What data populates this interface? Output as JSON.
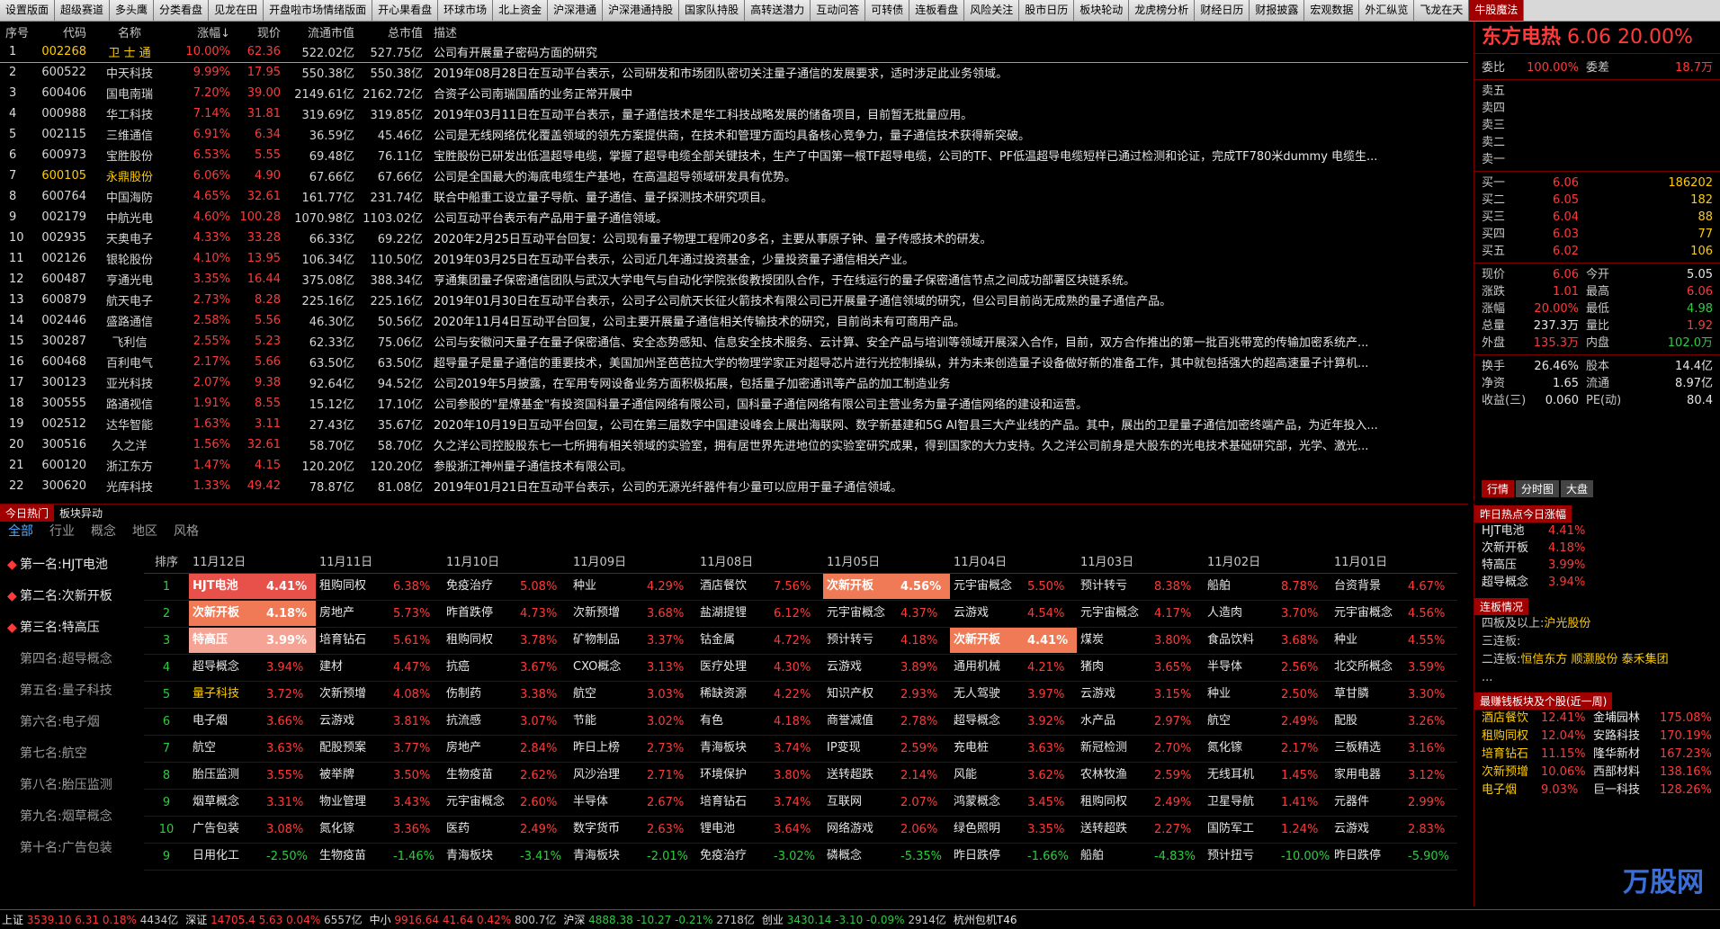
{
  "top_tabs": [
    "设置版面",
    "超级赛道",
    "多头鹰",
    "分类看盘",
    "见龙在田",
    "开盘啦市场情绪版面",
    "开心果看盘",
    "环球市场",
    "北上资金",
    "沪深港通",
    "沪深港通持股",
    "国家队持股",
    "高转送潜力",
    "互动问答",
    "可转债",
    "连板看盘",
    "风险关注",
    "股市日历",
    "板块轮动",
    "龙虎榜分析",
    "财经日历",
    "财报披露",
    "宏观数据",
    "外汇纵览",
    "飞龙在天",
    "牛股魔法"
  ],
  "stock_table": {
    "headers": [
      "序号",
      "代码",
      "名称",
      "涨幅↓",
      "现价",
      "流通市值",
      "总市值",
      "描述"
    ],
    "rows": [
      {
        "idx": "1",
        "code": "002268",
        "name": "卫 士 通",
        "chg": "10.00%",
        "price": "62.36",
        "float_cap": "522.02亿",
        "total_cap": "527.75亿",
        "desc": "公司有开展量子密码方面的研究"
      },
      {
        "idx": "2",
        "code": "600522",
        "name": "中天科技",
        "chg": "9.99%",
        "price": "17.95",
        "float_cap": "550.38亿",
        "total_cap": "550.38亿",
        "desc": "2019年08月28日在互动平台表示，公司研发和市场团队密切关注量子通信的发展要求，适时涉足此业务领域。"
      },
      {
        "idx": "3",
        "code": "600406",
        "name": "国电南瑞",
        "chg": "7.20%",
        "price": "39.00",
        "float_cap": "2149.61亿",
        "total_cap": "2162.72亿",
        "desc": "合资子公司南瑞国盾的业务正常开展中"
      },
      {
        "idx": "4",
        "code": "000988",
        "name": "华工科技",
        "chg": "7.14%",
        "price": "31.81",
        "float_cap": "319.69亿",
        "total_cap": "319.85亿",
        "desc": "2019年03月11日在互动平台表示，量子通信技术是华工科技战略发展的储备项目，目前暂无批量应用。"
      },
      {
        "idx": "5",
        "code": "002115",
        "name": "三维通信",
        "chg": "6.91%",
        "price": "6.34",
        "float_cap": "36.59亿",
        "total_cap": "45.46亿",
        "desc": "公司是无线网络优化覆盖领域的领先方案提供商，在技术和管理方面均具备核心竞争力，量子通信技术获得新突破。"
      },
      {
        "idx": "6",
        "code": "600973",
        "name": "宝胜股份",
        "chg": "6.53%",
        "price": "5.55",
        "float_cap": "69.48亿",
        "total_cap": "76.11亿",
        "desc": "宝胜股份已研发出低温超导电缆，掌握了超导电缆全部关键技术，生产了中国第一根TF超导电缆，公司的TF、PF低温超导电缆短样已通过检测和论证，完成TF780米dummy 电缆生..."
      },
      {
        "idx": "7",
        "code": "600105",
        "name": "永鼎股份",
        "chg": "6.06%",
        "price": "4.90",
        "float_cap": "67.66亿",
        "total_cap": "67.66亿",
        "desc": "公司是全国最大的海底电缆生产基地，在高温超导领域研发具有优势。"
      },
      {
        "idx": "8",
        "code": "600764",
        "name": "中国海防",
        "chg": "4.65%",
        "price": "32.61",
        "float_cap": "161.77亿",
        "total_cap": "231.74亿",
        "desc": "联合中船重工设立量子导航、量子通信、量子探测技术研究项目。"
      },
      {
        "idx": "9",
        "code": "002179",
        "name": "中航光电",
        "chg": "4.60%",
        "price": "100.28",
        "float_cap": "1070.98亿",
        "total_cap": "1103.02亿",
        "desc": "公司互动平台表示有产品用于量子通信领域。"
      },
      {
        "idx": "10",
        "code": "002935",
        "name": "天奥电子",
        "chg": "4.33%",
        "price": "33.28",
        "float_cap": "66.33亿",
        "total_cap": "69.22亿",
        "desc": "2020年2月25日互动平台回复：公司现有量子物理工程师20多名，主要从事原子钟、量子传感技术的研发。"
      },
      {
        "idx": "11",
        "code": "002126",
        "name": "银轮股份",
        "chg": "4.10%",
        "price": "13.95",
        "float_cap": "106.34亿",
        "total_cap": "110.50亿",
        "desc": "2019年03月25日在互动平台表示，公司近几年通过投资基金，少量投资量子通信相关产业。"
      },
      {
        "idx": "12",
        "code": "600487",
        "name": "亨通光电",
        "chg": "3.35%",
        "price": "16.44",
        "float_cap": "375.08亿",
        "total_cap": "388.34亿",
        "desc": "亨通集团量子保密通信团队与武汉大学电气与自动化学院张俊教授团队合作，于在线运行的量子保密通信节点之间成功部署区块链系统。"
      },
      {
        "idx": "13",
        "code": "600879",
        "name": "航天电子",
        "chg": "2.73%",
        "price": "8.28",
        "float_cap": "225.16亿",
        "total_cap": "225.16亿",
        "desc": "2019年01月30日在互动平台表示，公司子公司航天长征火箭技术有限公司已开展量子通信领域的研究，但公司目前尚无成熟的量子通信产品。"
      },
      {
        "idx": "14",
        "code": "002446",
        "name": "盛路通信",
        "chg": "2.58%",
        "price": "5.56",
        "float_cap": "46.30亿",
        "total_cap": "50.56亿",
        "desc": "2020年11月4日互动平台回复，公司主要开展量子通信相关传输技术的研究，目前尚未有可商用产品。"
      },
      {
        "idx": "15",
        "code": "300287",
        "name": "飞利信",
        "chg": "2.55%",
        "price": "5.23",
        "float_cap": "62.33亿",
        "total_cap": "75.06亿",
        "desc": "公司与安徽问天量子在量子保密通信、安全态势感知、信息安全技术服务、云计算、安全产品与培训等领域开展深入合作，目前，双方合作推出的第一批百兆带宽的传输加密系统产..."
      },
      {
        "idx": "16",
        "code": "600468",
        "name": "百利电气",
        "chg": "2.17%",
        "price": "5.66",
        "float_cap": "63.50亿",
        "total_cap": "63.50亿",
        "desc": "超导量子是量子通信的重要技术，美国加州圣芭芭拉大学的物理学家正对超导芯片进行光控制操纵，并为未来创造量子设备做好新的准备工作，其中就包括强大的超高速量子计算机..."
      },
      {
        "idx": "17",
        "code": "300123",
        "name": "亚光科技",
        "chg": "2.07%",
        "price": "9.38",
        "float_cap": "92.64亿",
        "total_cap": "94.52亿",
        "desc": "公司2019年5月披露，在军用专网设备业务方面积极拓展，包括量子加密通讯等产品的加工制造业务"
      },
      {
        "idx": "18",
        "code": "300555",
        "name": "路通视信",
        "chg": "1.91%",
        "price": "8.55",
        "float_cap": "15.12亿",
        "total_cap": "17.10亿",
        "desc": "公司参股的\"星燎基金\"有投资国科量子通信网络有限公司，国科量子通信网络有限公司主营业务为量子通信网络的建设和运营。"
      },
      {
        "idx": "19",
        "code": "002512",
        "name": "达华智能",
        "chg": "1.63%",
        "price": "3.11",
        "float_cap": "27.43亿",
        "total_cap": "35.67亿",
        "desc": "2020年10月19日互动平台回复，公司在第三届数字中国建设峰会上展出海联网、数字新基建和5G AI智县三大产业线的产品。其中，展出的卫星量子通信加密终端产品，为近年投入..."
      },
      {
        "idx": "20",
        "code": "300516",
        "name": "久之洋",
        "chg": "1.56%",
        "price": "32.61",
        "float_cap": "58.70亿",
        "total_cap": "58.70亿",
        "desc": "久之洋公司控股股东七一七所拥有相关领域的实验室，拥有居世界先进地位的实验室研究成果，得到国家的大力支持。久之洋公司前身是大股东的光电技术基础研究部，光学、激光..."
      },
      {
        "idx": "21",
        "code": "600120",
        "name": "浙江东方",
        "chg": "1.47%",
        "price": "4.15",
        "float_cap": "120.20亿",
        "total_cap": "120.20亿",
        "desc": "参股浙江神州量子通信技术有限公司。"
      },
      {
        "idx": "22",
        "code": "300620",
        "name": "光库科技",
        "chg": "1.33%",
        "price": "49.42",
        "float_cap": "78.87亿",
        "total_cap": "81.08亿",
        "desc": "2019年01月21日在互动平台表示，公司的无源光纤器件有少量可以应用于量子通信领域。"
      }
    ]
  },
  "quote": {
    "name": "东方电热",
    "price": "6.06",
    "chg": "20.00%",
    "weibi_label": "委比",
    "weibi": "100.00%",
    "weicha_label": "委差",
    "weicha": "18.7万",
    "sell": [
      {
        "label": "卖五",
        "price": "",
        "vol": ""
      },
      {
        "label": "卖四",
        "price": "",
        "vol": ""
      },
      {
        "label": "卖三",
        "price": "",
        "vol": ""
      },
      {
        "label": "卖二",
        "price": "",
        "vol": ""
      },
      {
        "label": "卖一",
        "price": "",
        "vol": ""
      }
    ],
    "buy": [
      {
        "label": "买一",
        "price": "6.06",
        "vol": "186202"
      },
      {
        "label": "买二",
        "price": "6.05",
        "vol": "182"
      },
      {
        "label": "买三",
        "price": "6.04",
        "vol": "88"
      },
      {
        "label": "买四",
        "price": "6.03",
        "vol": "77"
      },
      {
        "label": "买五",
        "price": "6.02",
        "vol": "106"
      }
    ],
    "stats": [
      {
        "l1": "现价",
        "v1": "6.06",
        "l2": "今开",
        "v2": "5.05"
      },
      {
        "l1": "涨跌",
        "v1": "1.01",
        "l2": "最高",
        "v2": "6.06"
      },
      {
        "l1": "涨幅",
        "v1": "20.00%",
        "l2": "最低",
        "v2": "4.98"
      },
      {
        "l1": "总量",
        "v1": "237.3万",
        "l2": "量比",
        "v2": "1.92"
      },
      {
        "l1": "外盘",
        "v1": "135.3万",
        "l2": "内盘",
        "v2": "102.0万"
      }
    ],
    "stats2": [
      {
        "l1": "换手",
        "v1": "26.46%",
        "l2": "股本",
        "v2": "14.4亿"
      },
      {
        "l1": "净资",
        "v1": "1.65",
        "l2": "流通",
        "v2": "8.97亿"
      },
      {
        "l1": "收益(三)",
        "v1": "0.060",
        "l2": "PE(动)",
        "v2": "80.4"
      }
    ],
    "tabs": [
      "行情",
      "分时图",
      "大盘"
    ]
  },
  "hot": {
    "tabs": [
      "今日热门",
      "板块异动"
    ],
    "filters": [
      "全部",
      "行业",
      "概念",
      "地区",
      "风格"
    ],
    "ranks": [
      {
        "label": "第一名:HJT电池",
        "top": true
      },
      {
        "label": "第二名:次新开板",
        "top": true
      },
      {
        "label": "第三名:特高压",
        "top": true
      },
      {
        "label": "第四名:超导概念",
        "top": false
      },
      {
        "label": "第五名:量子科技",
        "top": false
      },
      {
        "label": "第六名:电子烟",
        "top": false
      },
      {
        "label": "第七名:航空",
        "top": false
      },
      {
        "label": "第八名:胎压监测",
        "top": false
      },
      {
        "label": "第九名:烟草概念",
        "top": false
      },
      {
        "label": "第十名:广告包装",
        "top": false
      }
    ],
    "rank_header": "排序",
    "dates": [
      "11月12日",
      "11月11日",
      "11月10日",
      "11月09日",
      "11月08日",
      "11月05日",
      "11月04日",
      "11月03日",
      "11月02日",
      "11月01日"
    ],
    "rank_nums": [
      "1",
      "2",
      "3",
      "4",
      "5",
      "6",
      "7",
      "8",
      "9",
      "10",
      "9"
    ],
    "rows": [
      [
        [
          "HJT电池",
          "4.41%"
        ],
        [
          "租购同权",
          "6.38%"
        ],
        [
          "免疫治疗",
          "5.08%"
        ],
        [
          "种业",
          "4.29%"
        ],
        [
          "酒店餐饮",
          "7.56%"
        ],
        [
          "次新开板",
          "4.56%"
        ],
        [
          "元宇宙概念",
          "5.50%"
        ],
        [
          "预计转亏",
          "8.38%"
        ],
        [
          "船舶",
          "8.78%"
        ],
        [
          "台资背景",
          "4.67%"
        ]
      ],
      [
        [
          "次新开板",
          "4.18%"
        ],
        [
          "房地产",
          "5.73%"
        ],
        [
          "昨首跌停",
          "4.73%"
        ],
        [
          "次新预增",
          "3.68%"
        ],
        [
          "盐湖提锂",
          "6.12%"
        ],
        [
          "元宇宙概念",
          "4.37%"
        ],
        [
          "云游戏",
          "4.54%"
        ],
        [
          "元宇宙概念",
          "4.17%"
        ],
        [
          "人造肉",
          "3.70%"
        ],
        [
          "元宇宙概念",
          "4.56%"
        ]
      ],
      [
        [
          "特高压",
          "3.99%"
        ],
        [
          "培育钻石",
          "5.61%"
        ],
        [
          "租购同权",
          "3.78%"
        ],
        [
          "矿物制品",
          "3.37%"
        ],
        [
          "钴金属",
          "4.72%"
        ],
        [
          "预计转亏",
          "4.18%"
        ],
        [
          "次新开板",
          "4.41%"
        ],
        [
          "煤炭",
          "3.80%"
        ],
        [
          "食品饮料",
          "3.68%"
        ],
        [
          "种业",
          "4.55%"
        ]
      ],
      [
        [
          "超导概念",
          "3.94%"
        ],
        [
          "建材",
          "4.47%"
        ],
        [
          "抗癌",
          "3.67%"
        ],
        [
          "CXO概念",
          "3.13%"
        ],
        [
          "医疗处理",
          "4.30%"
        ],
        [
          "云游戏",
          "3.89%"
        ],
        [
          "通用机械",
          "4.21%"
        ],
        [
          "猪肉",
          "3.65%"
        ],
        [
          "半导体",
          "2.56%"
        ],
        [
          "北交所概念",
          "3.59%"
        ]
      ],
      [
        [
          "量子科技",
          "3.72%"
        ],
        [
          "次新预增",
          "4.08%"
        ],
        [
          "伤制药",
          "3.38%"
        ],
        [
          "航空",
          "3.03%"
        ],
        [
          "稀缺资源",
          "4.22%"
        ],
        [
          "知识产权",
          "2.93%"
        ],
        [
          "无人驾驶",
          "3.97%"
        ],
        [
          "云游戏",
          "3.15%"
        ],
        [
          "种业",
          "2.50%"
        ],
        [
          "草甘膦",
          "3.30%"
        ]
      ],
      [
        [
          "电子烟",
          "3.66%"
        ],
        [
          "云游戏",
          "3.81%"
        ],
        [
          "抗流感",
          "3.07%"
        ],
        [
          "节能",
          "3.02%"
        ],
        [
          "有色",
          "4.18%"
        ],
        [
          "商誉减值",
          "2.78%"
        ],
        [
          "超导概念",
          "3.92%"
        ],
        [
          "水产品",
          "2.97%"
        ],
        [
          "航空",
          "2.49%"
        ],
        [
          "配股",
          "3.26%"
        ]
      ],
      [
        [
          "航空",
          "3.63%"
        ],
        [
          "配股预案",
          "3.77%"
        ],
        [
          "房地产",
          "2.84%"
        ],
        [
          "昨日上榜",
          "2.73%"
        ],
        [
          "青海板块",
          "3.74%"
        ],
        [
          "IP变现",
          "2.59%"
        ],
        [
          "充电桩",
          "3.63%"
        ],
        [
          "新冠检测",
          "2.70%"
        ],
        [
          "氮化镓",
          "2.17%"
        ],
        [
          "三板精选",
          "3.16%"
        ]
      ],
      [
        [
          "胎压监测",
          "3.55%"
        ],
        [
          "被举牌",
          "3.50%"
        ],
        [
          "生物疫苗",
          "2.62%"
        ],
        [
          "风沙治理",
          "2.71%"
        ],
        [
          "环境保护",
          "3.80%"
        ],
        [
          "送转超跌",
          "2.14%"
        ],
        [
          "风能",
          "3.62%"
        ],
        [
          "农林牧渔",
          "2.59%"
        ],
        [
          "无线耳机",
          "1.45%"
        ],
        [
          "家用电器",
          "3.12%"
        ]
      ],
      [
        [
          "烟草概念",
          "3.31%"
        ],
        [
          "物业管理",
          "3.43%"
        ],
        [
          "元宇宙概念",
          "2.60%"
        ],
        [
          "半导体",
          "2.67%"
        ],
        [
          "培育钻石",
          "3.74%"
        ],
        [
          "互联网",
          "2.07%"
        ],
        [
          "鸿蒙概念",
          "3.45%"
        ],
        [
          "租购同权",
          "2.49%"
        ],
        [
          "卫星导航",
          "1.41%"
        ],
        [
          "元器件",
          "2.99%"
        ]
      ],
      [
        [
          "广告包装",
          "3.08%"
        ],
        [
          "氮化镓",
          "3.36%"
        ],
        [
          "医药",
          "2.49%"
        ],
        [
          "数字货币",
          "2.63%"
        ],
        [
          "锂电池",
          "3.64%"
        ],
        [
          "网络游戏",
          "2.06%"
        ],
        [
          "绿色照明",
          "3.35%"
        ],
        [
          "送转超跌",
          "2.27%"
        ],
        [
          "国防军工",
          "1.24%"
        ],
        [
          "云游戏",
          "2.83%"
        ]
      ],
      [
        [
          "日用化工",
          "-2.50%"
        ],
        [
          "生物疫苗",
          "-1.46%"
        ],
        [
          "青海板块",
          "-3.41%"
        ],
        [
          "青海板块",
          "-2.01%"
        ],
        [
          "免疫治疗",
          "-3.02%"
        ],
        [
          "磷概念",
          "-5.35%"
        ],
        [
          "昨日跌停",
          "-1.66%"
        ],
        [
          "船舶",
          "-4.83%"
        ],
        [
          "预计扭亏",
          "-10.00%"
        ],
        [
          "昨日跌停",
          "-5.90%"
        ]
      ]
    ]
  },
  "side": {
    "yesterday_title": "昨日热点今日涨幅",
    "yesterday": [
      {
        "name": "HJT电池",
        "chg": "4.41%"
      },
      {
        "name": "次新开板",
        "chg": "4.18%"
      },
      {
        "name": "特高压",
        "chg": "3.99%"
      },
      {
        "name": "超导概念",
        "chg": "3.94%"
      }
    ],
    "lianban_title": "连板情况",
    "lianban": [
      {
        "label": "四板及以上:",
        "val": "沪光股份"
      },
      {
        "label": "三连板:",
        "val": ""
      },
      {
        "label": "二连板:",
        "val": "恒信东方  顺灏股份  泰禾集团"
      },
      {
        "label": "...",
        "val": ""
      }
    ],
    "best_title": "最赚钱板块及个股(近一周)",
    "best": [
      {
        "a": "酒店餐饮",
        "b": "12.41%",
        "c": "金埔园林",
        "d": "175.08%"
      },
      {
        "a": "租购同权",
        "b": "12.04%",
        "c": "安路科技",
        "d": "170.19%"
      },
      {
        "a": "培育钻石",
        "b": "11.15%",
        "c": "隆华新材",
        "d": "167.23%"
      },
      {
        "a": "次新预增",
        "b": "10.06%",
        "c": "西部材料",
        "d": "138.16%"
      },
      {
        "a": "电子烟",
        "b": "9.03%",
        "c": "巨一科技",
        "d": "128.26%"
      }
    ],
    "watermark": "万股网"
  },
  "status": [
    {
      "name": "上证",
      "vals": [
        [
          "3539.10",
          "up"
        ],
        [
          "6.31",
          "up"
        ],
        [
          "0.18%",
          "up"
        ],
        [
          "4434亿",
          "wh"
        ]
      ]
    },
    {
      "name": "深证",
      "vals": [
        [
          "14705.4",
          "up"
        ],
        [
          "5.63",
          "up"
        ],
        [
          "0.04%",
          "up"
        ],
        [
          "6557亿",
          "wh"
        ]
      ]
    },
    {
      "name": "中小",
      "vals": [
        [
          "9916.64",
          "up"
        ],
        [
          "41.64",
          "up"
        ],
        [
          "0.42%",
          "up"
        ],
        [
          "800.7亿",
          "wh"
        ]
      ]
    },
    {
      "name": "沪深",
      "vals": [
        [
          "4888.38",
          "dn"
        ],
        [
          "-10.27",
          "dn"
        ],
        [
          "-0.21%",
          "dn"
        ],
        [
          "2718亿",
          "wh"
        ]
      ]
    },
    {
      "name": "创业",
      "vals": [
        [
          "3430.14",
          "dn"
        ],
        [
          "-3.10",
          "dn"
        ],
        [
          "-0.09%",
          "dn"
        ],
        [
          "2914亿",
          "wh"
        ]
      ]
    },
    {
      "name": "杭州包机T46",
      "vals": []
    }
  ]
}
